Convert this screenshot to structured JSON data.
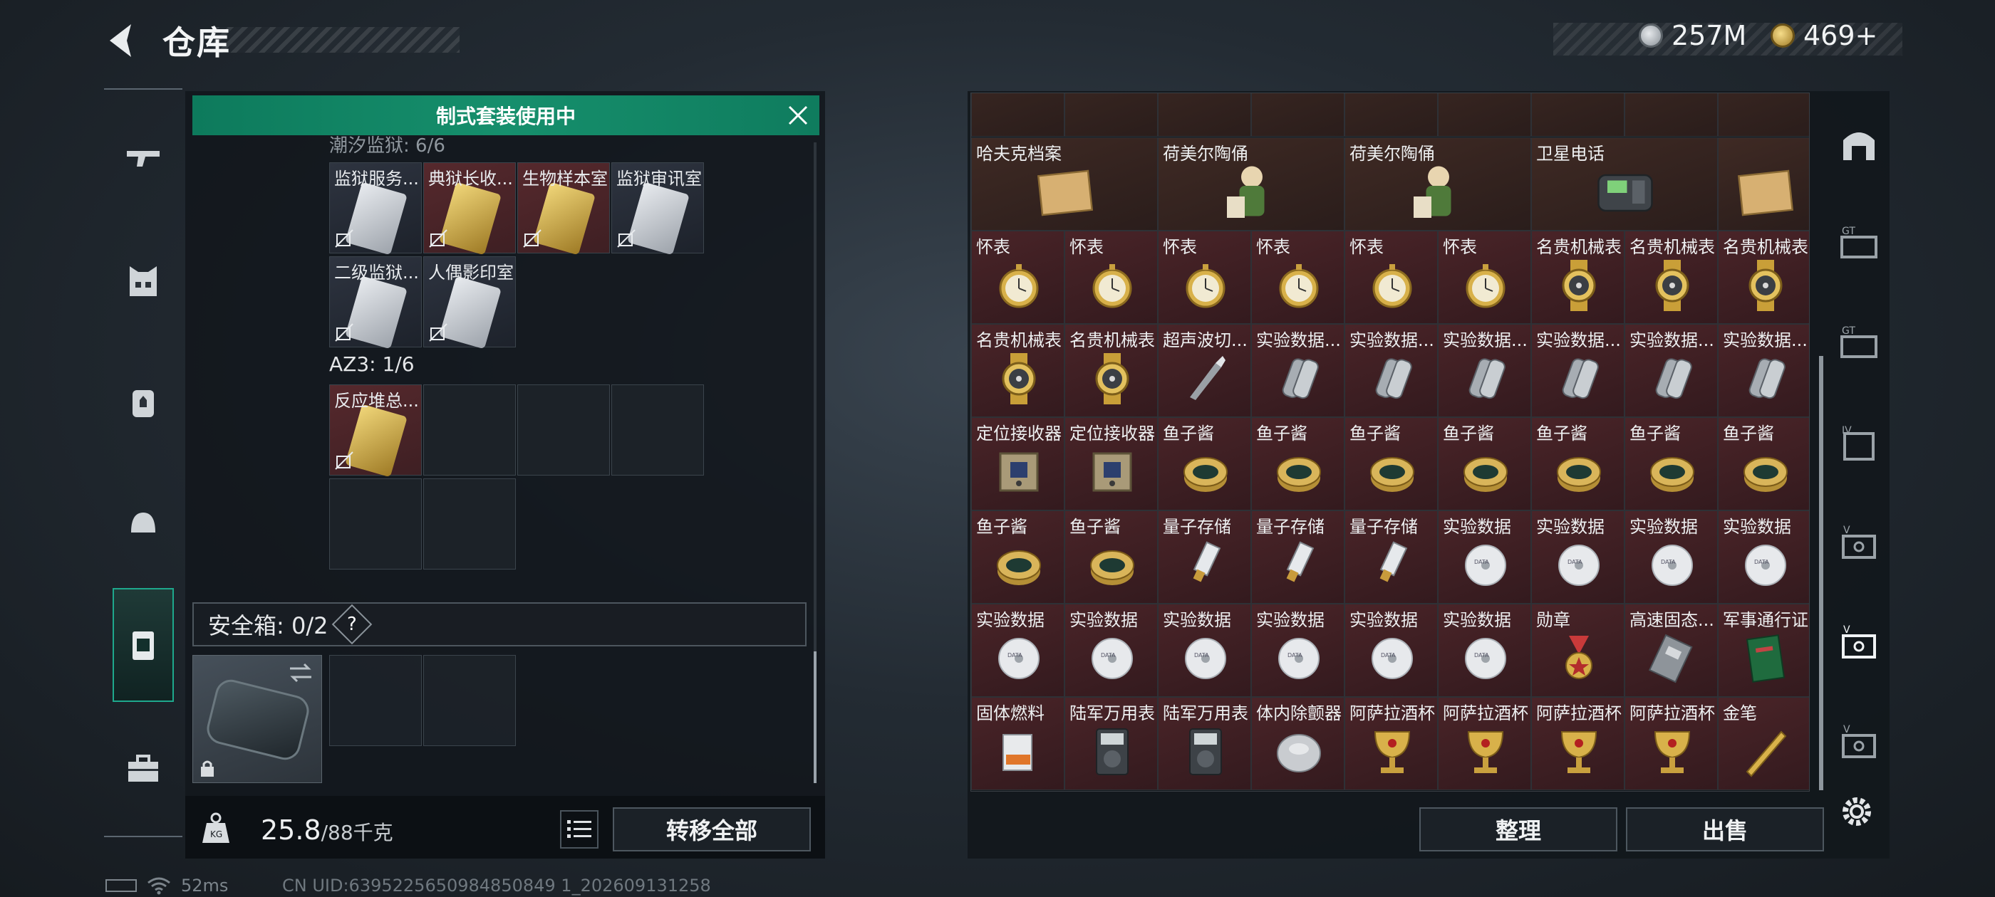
{
  "header": {
    "title": "仓库",
    "currency_silver": "257M",
    "currency_gold": "469+"
  },
  "left_nav": {
    "items": [
      "weapon-icon",
      "armor-icon",
      "backpack-icon",
      "helmet-icon",
      "safe-box-icon",
      "toolbox-icon"
    ],
    "active": "safe-box-icon"
  },
  "loadout": {
    "kit_banner": "制式套装使用中",
    "partial_heading": "潮汐监狱: 6/6",
    "keys": [
      {
        "label": "监狱服务...",
        "style": "silver"
      },
      {
        "label": "典狱长收...",
        "style": "gold"
      },
      {
        "label": "生物样本室",
        "style": "gold"
      },
      {
        "label": "监狱审讯室",
        "style": "silver"
      },
      {
        "label": "二级监狱...",
        "style": "silver"
      },
      {
        "label": "人偶影印室",
        "style": "silver"
      }
    ],
    "az3_label": "AZ3: 1/6",
    "az3_keys": [
      {
        "label": "反应堆总...",
        "style": "gold"
      }
    ],
    "safe_box_label": "安全箱: 0/2",
    "safe_box_help": "?",
    "weight_value": "25.8",
    "weight_capacity": "/88千克",
    "transfer_all": "转移全部"
  },
  "stash": {
    "top_row": [
      "",
      "",
      "",
      "",
      ""
    ],
    "rows": [
      [
        {
          "label": "哈夫克档案",
          "icon": "document-icon",
          "span": 2
        },
        {
          "label": "荷美尔陶俑",
          "icon": "figurine-icon",
          "span": 2
        },
        {
          "label": "荷美尔陶俑",
          "icon": "figurine-icon",
          "span": 2
        },
        {
          "label": "卫星电话",
          "icon": "satellite-phone-icon",
          "span": 2
        },
        {
          "label": "",
          "icon": "document-icon",
          "span": 1
        }
      ]
    ],
    "cells": [
      [
        "怀表",
        "怀表",
        "怀表",
        "怀表",
        "怀表",
        "怀表",
        "名贵机械表",
        "名贵机械表",
        "名贵机械表"
      ],
      [
        "名贵机械表",
        "名贵机械表",
        "超声波切...",
        "实验数据...",
        "实验数据...",
        "实验数据...",
        "实验数据...",
        "实验数据...",
        "实验数据..."
      ],
      [
        "定位接收器",
        "定位接收器",
        "鱼子酱",
        "鱼子酱",
        "鱼子酱",
        "鱼子酱",
        "鱼子酱",
        "鱼子酱",
        "鱼子酱"
      ],
      [
        "鱼子酱",
        "鱼子酱",
        "量子存储",
        "量子存储",
        "量子存储",
        "实验数据",
        "实验数据",
        "实验数据",
        "实验数据"
      ],
      [
        "实验数据",
        "实验数据",
        "实验数据",
        "实验数据",
        "实验数据",
        "实验数据",
        "勋章",
        "高速固态...",
        "军事通行证"
      ],
      [
        "固体燃料",
        "陆军万用表",
        "陆军万用表",
        "体内除颤器",
        "阿萨拉酒杯",
        "阿萨拉酒杯",
        "阿萨拉酒杯",
        "阿萨拉酒杯",
        "金笔"
      ]
    ],
    "cell_icons": [
      [
        "pocket-watch-icon",
        "pocket-watch-icon",
        "pocket-watch-icon",
        "pocket-watch-icon",
        "pocket-watch-icon",
        "pocket-watch-icon",
        "luxury-watch-icon",
        "luxury-watch-icon",
        "luxury-watch-icon"
      ],
      [
        "luxury-watch-icon",
        "luxury-watch-icon",
        "ultrasonic-cutter-icon",
        "data-cylinder-icon",
        "data-cylinder-icon",
        "data-cylinder-icon",
        "data-cylinder-icon",
        "data-cylinder-icon",
        "data-cylinder-icon"
      ],
      [
        "locator-icon",
        "locator-icon",
        "caviar-tin-icon",
        "caviar-tin-icon",
        "caviar-tin-icon",
        "caviar-tin-icon",
        "caviar-tin-icon",
        "caviar-tin-icon",
        "caviar-tin-icon"
      ],
      [
        "caviar-tin-icon",
        "caviar-tin-icon",
        "usb-drive-icon",
        "usb-drive-icon",
        "usb-drive-icon",
        "disc-icon",
        "disc-icon",
        "disc-icon",
        "disc-icon"
      ],
      [
        "disc-icon",
        "disc-icon",
        "disc-icon",
        "disc-icon",
        "disc-icon",
        "disc-icon",
        "medal-icon",
        "ssd-icon",
        "passbook-icon"
      ],
      [
        "fuel-can-icon",
        "multimeter-icon",
        "multimeter-icon",
        "defibrillator-icon",
        "goblet-icon",
        "goblet-icon",
        "goblet-icon",
        "goblet-icon",
        "gold-pen-icon"
      ]
    ],
    "sort_label": "整理",
    "sell_label": "出售"
  },
  "status": {
    "ping": "52ms",
    "uid": "CN UID:6395225650984850849 1_202609131258"
  },
  "colors": {
    "accent_green": "#168f6c",
    "cell_red": "#4a2428",
    "panel_bg": "#12171c"
  }
}
